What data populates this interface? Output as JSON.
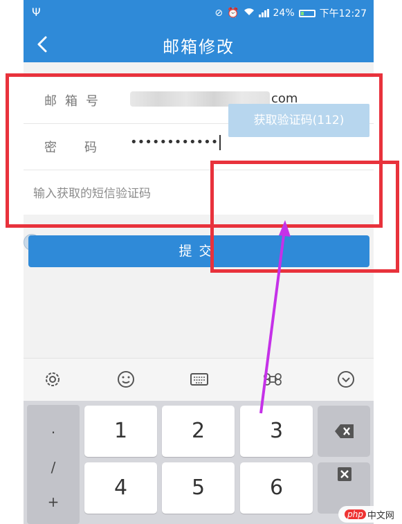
{
  "status_bar": {
    "battery_percent": "24%",
    "time": "下午12:27",
    "battery_level": 0.24,
    "icons": [
      "usb-icon",
      "mute-icon",
      "alarm-icon",
      "wifi-icon",
      "signal-icon",
      "battery-icon"
    ]
  },
  "header": {
    "title": "邮箱修改",
    "back_icon": "chevron-left-icon"
  },
  "form": {
    "email_label": "邮箱号",
    "email_value_suffix": "com",
    "password_label": "密码",
    "password_value": "••••••••••••",
    "code_placeholder": "输入获取的短信验证码",
    "get_code_button": "获取验证码(112)"
  },
  "submit_button": "提交",
  "keyboard": {
    "toolbar_icons": [
      "gear-icon",
      "emoji-icon",
      "keyboard-icon",
      "command-icon",
      "collapse-down-icon"
    ],
    "symbols": [
      "·",
      "/",
      "+"
    ],
    "keys": [
      "1",
      "2",
      "3",
      "4",
      "5",
      "6"
    ]
  },
  "watermark": {
    "logo": "php",
    "text": "中文网"
  },
  "colors": {
    "primary": "#2f8ad8",
    "disabled_button": "#b7d6ee",
    "annotation_red": "#e8323c",
    "annotation_arrow": "#c531e8"
  }
}
